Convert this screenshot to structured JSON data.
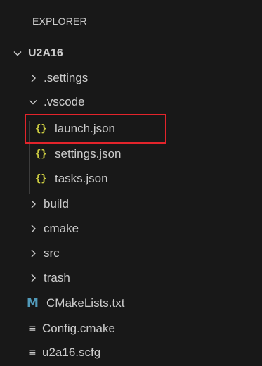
{
  "explorer": {
    "title": "EXPLORER",
    "root": {
      "label": "U2A16",
      "expanded": true
    },
    "items": [
      {
        "label": ".settings",
        "type": "folder",
        "expanded": false
      },
      {
        "label": ".vscode",
        "type": "folder",
        "expanded": true
      },
      {
        "label": "launch.json",
        "type": "json",
        "icon": "{}",
        "highlighted": true
      },
      {
        "label": "settings.json",
        "type": "json",
        "icon": "{}"
      },
      {
        "label": "tasks.json",
        "type": "json",
        "icon": "{}"
      },
      {
        "label": "build",
        "type": "folder",
        "expanded": false
      },
      {
        "label": "cmake",
        "type": "folder",
        "expanded": false
      },
      {
        "label": "src",
        "type": "folder",
        "expanded": false
      },
      {
        "label": "trash",
        "type": "folder",
        "expanded": false
      },
      {
        "label": "CMakeLists.txt",
        "type": "markdown",
        "icon": "M"
      },
      {
        "label": "Config.cmake",
        "type": "text",
        "icon": "≡"
      },
      {
        "label": "u2a16.scfg",
        "type": "text",
        "icon": "≡"
      }
    ]
  },
  "colors": {
    "background": "#181818",
    "text": "#cccccc",
    "json_icon": "#cbcb41",
    "markdown_icon": "#519aba",
    "highlight_border": "#e3242b"
  }
}
